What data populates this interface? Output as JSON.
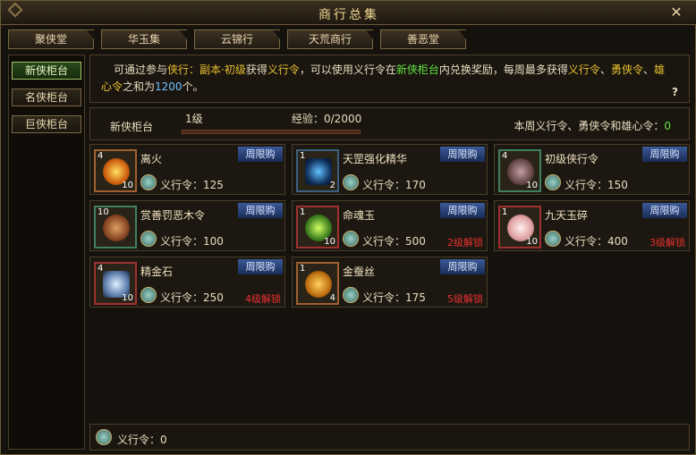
{
  "title": "商行总集",
  "tabs": [
    "聚侠堂",
    "华玉集",
    "云锦行",
    "天荒商行",
    "善恶堂"
  ],
  "sidebar": [
    "新侠柜台",
    "名侠柜台",
    "巨侠柜台"
  ],
  "desc": {
    "p1": "可通过参与",
    "p2": "侠行：副本·初级",
    "p3": "获得",
    "p4": "义行令",
    "p5": "，可以使用义行令在",
    "p6": "新侠柜台",
    "p7": "内兑换奖励，每周最多获得",
    "p8": "义行令",
    "p9": "、",
    "p10": "勇侠令",
    "p11": "、",
    "p12": "雄心令",
    "p13": "之和为",
    "p14": "1200",
    "p15": "个。",
    "help": "?"
  },
  "info": {
    "label": "新侠柜台",
    "level": "1级",
    "exp": "经验：0/2000",
    "exp_progress": 0,
    "weekly_label": "本周义行令、勇侠令和雄心令：",
    "weekly_value": "0"
  },
  "items": [
    {
      "name": "离火",
      "qty": "4",
      "count": "10",
      "badge": "周限购",
      "currency": "义行令：",
      "price": "125",
      "lock": ""
    },
    {
      "name": "天罡强化精华",
      "qty": "1",
      "count": "2",
      "badge": "周限购",
      "currency": "义行令：",
      "price": "170",
      "lock": ""
    },
    {
      "name": "初级侠行令",
      "qty": "4",
      "count": "10",
      "badge": "周限购",
      "currency": "义行令：",
      "price": "150",
      "lock": ""
    },
    {
      "name": "赏善罚恶木令",
      "qty": "10",
      "count": "",
      "badge": "周限购",
      "currency": "义行令：",
      "price": "100",
      "lock": ""
    },
    {
      "name": "命魂玉",
      "qty": "1",
      "count": "10",
      "badge": "周限购",
      "currency": "义行令：",
      "price": "500",
      "lock": "2级解锁"
    },
    {
      "name": "九天玉碎",
      "qty": "1",
      "count": "10",
      "badge": "周限购",
      "currency": "义行令：",
      "price": "400",
      "lock": "3级解锁"
    },
    {
      "name": "精金石",
      "qty": "4",
      "count": "10",
      "badge": "周限购",
      "currency": "义行令：",
      "price": "250",
      "lock": "4级解锁"
    },
    {
      "name": "金蚕丝",
      "qty": "1",
      "count": "4",
      "badge": "周限购",
      "currency": "义行令：",
      "price": "175",
      "lock": "5级解锁"
    }
  ],
  "footer": {
    "text": "义行令：0"
  },
  "colors": {
    "gold": "#e8c030",
    "green": "#60e040",
    "blue_text": "#70c0ff",
    "lock_red": "#e83030"
  }
}
